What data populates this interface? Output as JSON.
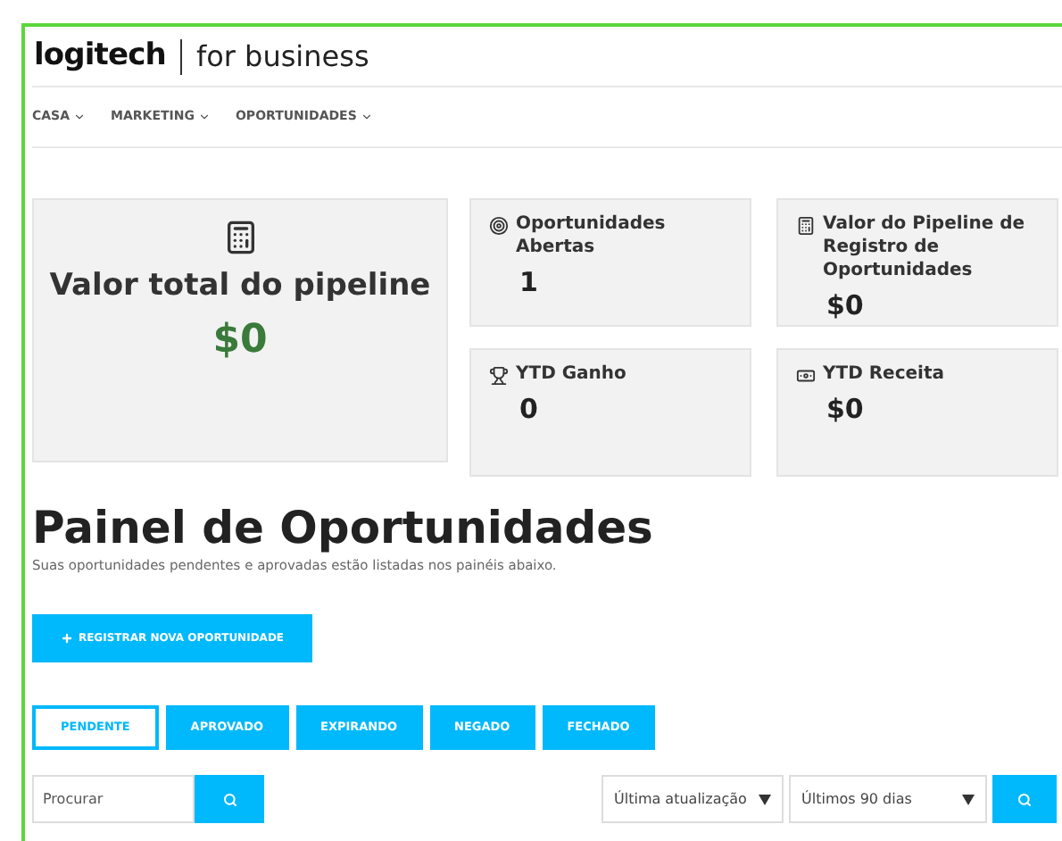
{
  "header": {
    "logo": "logitech",
    "logo_suffix": "for business"
  },
  "nav": [
    {
      "label": "CASA"
    },
    {
      "label": "MARKETING"
    },
    {
      "label": "OPORTUNIDADES"
    }
  ],
  "summary": {
    "title": "Valor total do pipeline",
    "value": "$0"
  },
  "stats": [
    {
      "kind": "target",
      "label": "Oportunidades Abertas",
      "value": "1"
    },
    {
      "kind": "calculator",
      "label": "Valor do Pipeline de Registro de Oportunidades",
      "value": "$0"
    },
    {
      "kind": "trophy",
      "label": "YTD Ganho",
      "value": "0"
    },
    {
      "kind": "money",
      "label": "YTD Receita",
      "value": "$0"
    }
  ],
  "heading": "Painel de Oportunidades",
  "subtitle": "Suas oportunidades pendentes e aprovadas estão listadas nos painéis abaixo.",
  "register_button": "REGISTRAR NOVA OPORTUNIDADE",
  "tabs": [
    {
      "label": "PENDENTE",
      "selected": true
    },
    {
      "label": "APROVADO",
      "selected": false
    },
    {
      "label": "EXPIRANDO",
      "selected": false
    },
    {
      "label": "NEGADO",
      "selected": false
    },
    {
      "label": "FECHADO",
      "selected": false
    }
  ],
  "search": {
    "placeholder": "Procurar"
  },
  "filters": [
    {
      "value": "Última atualização"
    },
    {
      "value": "Últimos 90 dias"
    }
  ]
}
